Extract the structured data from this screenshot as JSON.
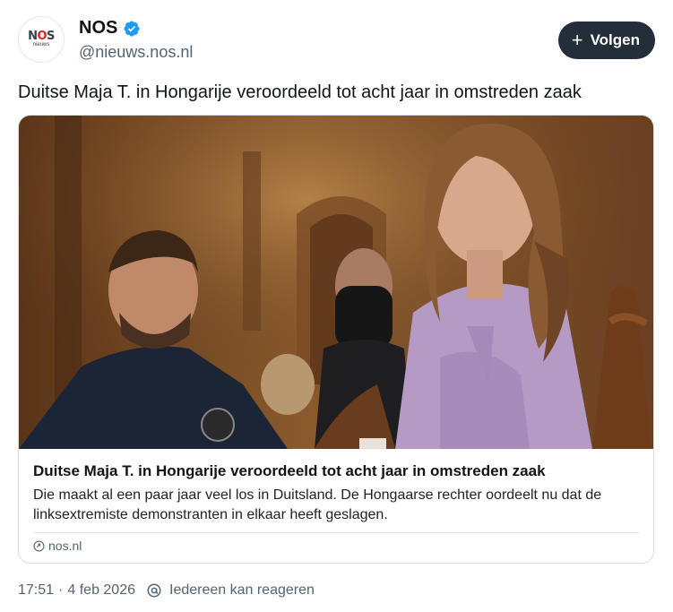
{
  "author": {
    "display_name": "NOS",
    "handle": "@nieuws.nos.nl",
    "avatar_text_main": "NOS",
    "avatar_text_sub": "nieuws",
    "verified": true,
    "avatar_icon": "nos-logo"
  },
  "follow_button": {
    "label": "Volgen",
    "icon": "plus-icon"
  },
  "post": {
    "text": "Duitse Maja T. in Hongarije veroordeeld tot acht jaar in omstreden zaak"
  },
  "link_card": {
    "image_icon": "courtroom-photo",
    "title": "Duitse Maja T. in Hongarije veroordeeld tot acht jaar in omstreden zaak",
    "description": "Die maakt al een paar jaar veel los in Duitsland. De Hongaarse rechter oordeelt nu dat de linksextremiste demonstranten in elkaar heeft geslagen.",
    "domain": "nos.nl",
    "domain_icon": "link-icon"
  },
  "meta": {
    "time": "17:51",
    "separator": "·",
    "date": "4 feb 2026",
    "reply_setting": "Iedereen kan reageren",
    "reply_icon": "at-sign-icon"
  },
  "colors": {
    "follow_bg": "#242e3a",
    "verified_blue": "#1d9bf0",
    "secondary_text": "#536471",
    "logo_red": "#e2231a"
  }
}
